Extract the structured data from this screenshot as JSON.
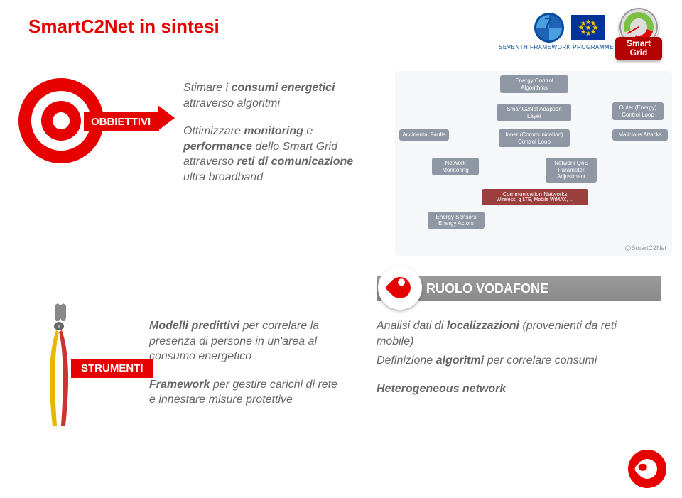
{
  "title": "SmartC2Net in sintesi",
  "gauge": {
    "line1": "Smart",
    "line2": "Grid"
  },
  "fp_caption": "SEVENTH FRAMEWORK PROGRAMME",
  "obiettivi_label": "OBBIETTIVI",
  "obj": {
    "l1a": "Stimare i ",
    "l1b": "consumi energetici",
    "l2": "attraverso algoritmi",
    "l3a": "Ottimizzare ",
    "l3b": "monitoring",
    "l3c": " e ",
    "l4a": "performance",
    "l4b": " dello Smart Grid attraverso ",
    "l5a": "reti di comunicazione",
    "l5b": " ultra broadband"
  },
  "diagram": {
    "top1": "Energy Control Algorithms",
    "mid1": "SmartC2Net Adaption Layer",
    "mid2": "Inner (Communication) Control Loop",
    "out": "Outer (Energy) Control Loop",
    "acc": "Accidental Faults",
    "mal": "Malicious Attacks",
    "nmon": "Network Monitoring",
    "nqos": "Network QoS Parameter Adjustment",
    "comm_l1": "Communication Networks",
    "comm_l2": "Wireless: g LTE, Mobile WiMAX, ...",
    "sens_l1": "Energy Sensors",
    "sens_l2": "Energy Actors",
    "brand": "@SmartC2Net"
  },
  "ruolo": "RUOLO VODAFONE",
  "strumenti_label": "STRUMENTI",
  "left": {
    "b1_a": "Modelli predittivi",
    "b1_b": " per correlare la presenza di persone in un'area al consumo  energetico",
    "b2_a": "Framework",
    "b2_b": " per gestire carichi di rete e innestare misure protettive"
  },
  "right": {
    "b1_a": "Analisi dati di ",
    "b1_b": "localizzazioni",
    "b1_c": " (provenienti da reti mobile)",
    "b2_a": "Definizione ",
    "b2_b": "algoritmi",
    "b2_c": " per correlare consumi",
    "b3": "Heterogeneous network"
  }
}
